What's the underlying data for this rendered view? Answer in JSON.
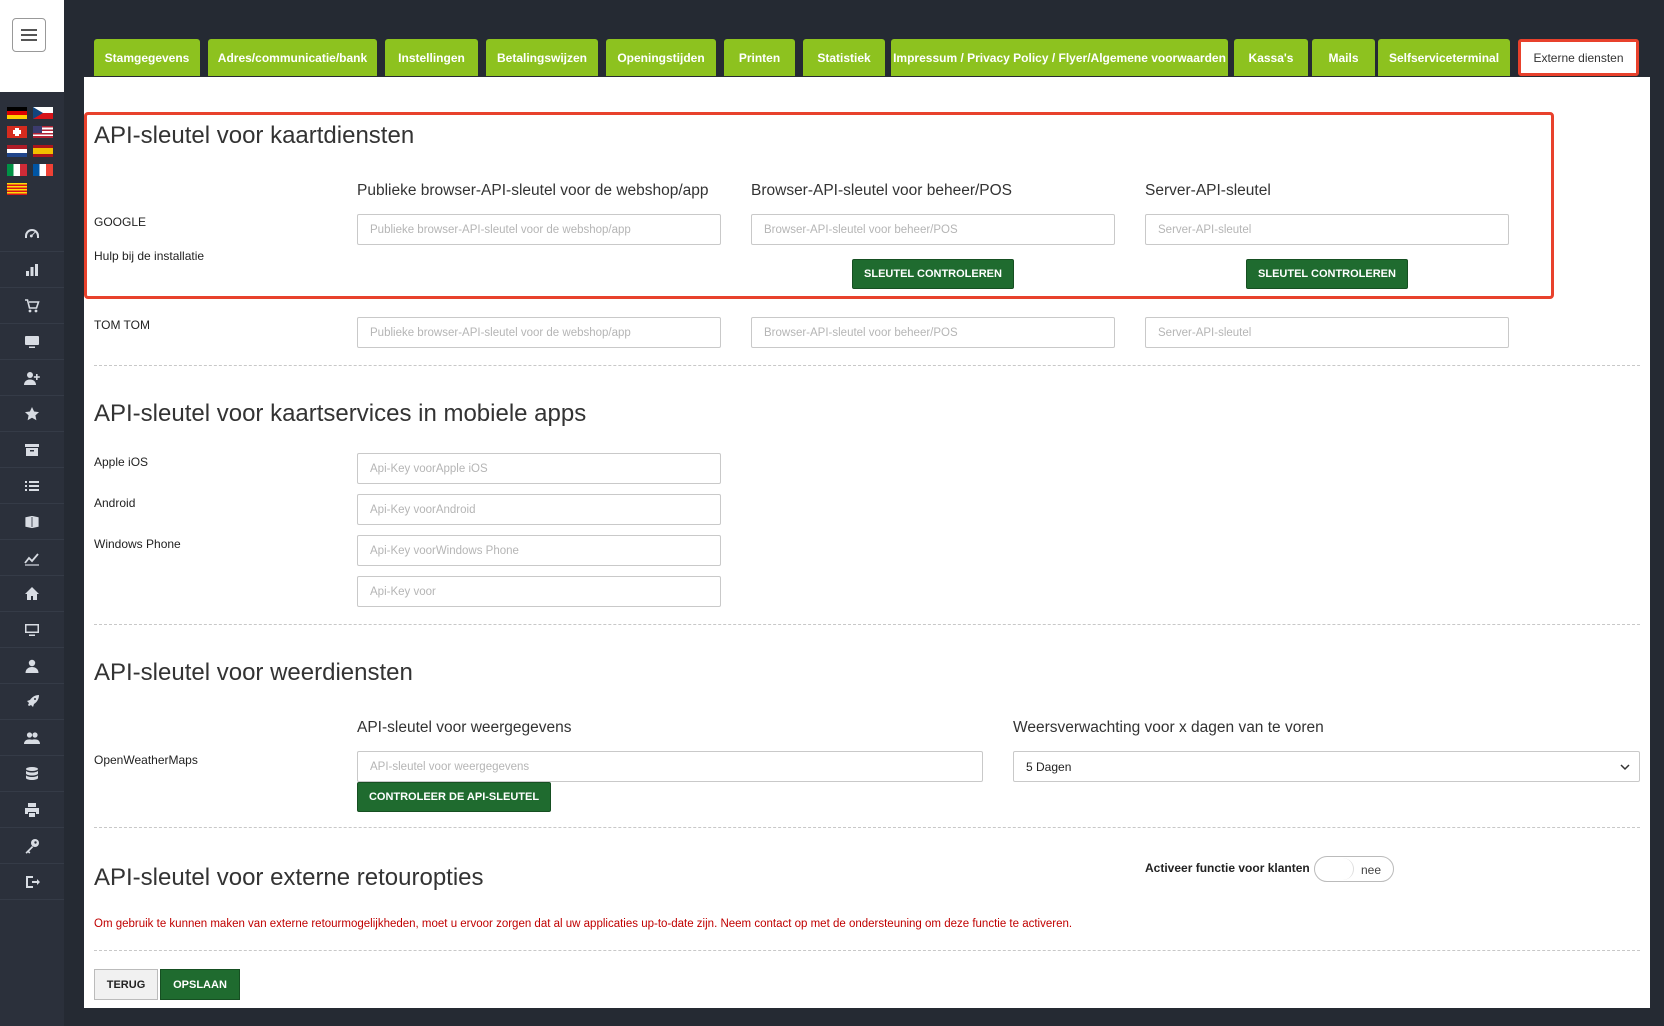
{
  "sidebar": {
    "flags": [
      {
        "icon": "flag-de-icon"
      },
      {
        "icon": "flag-cz-icon"
      },
      {
        "icon": "flag-ch-icon"
      },
      {
        "icon": "flag-us-icon"
      },
      {
        "icon": "flag-nl-icon"
      },
      {
        "icon": "flag-es-icon"
      },
      {
        "icon": "flag-it-icon"
      },
      {
        "icon": "flag-fr-icon"
      },
      {
        "icon": "flag-ca-icon"
      }
    ],
    "nav_icons": [
      "dashboard-icon",
      "bar-chart-icon",
      "cart-icon",
      "monitor-icon",
      "user-plus-icon",
      "star-icon",
      "archive-icon",
      "list-icon",
      "book-icon",
      "line-chart-icon",
      "home-icon",
      "desktop-icon",
      "user-icon",
      "rocket-icon",
      "users-icon",
      "database-icon",
      "printer-icon",
      "key-icon",
      "logout-icon"
    ]
  },
  "tabs": [
    {
      "label": "Stamgegevens"
    },
    {
      "label": "Adres/communicatie/bank"
    },
    {
      "label": "Instellingen"
    },
    {
      "label": "Betalingswijzen"
    },
    {
      "label": "Openingstijden"
    },
    {
      "label": "Printen"
    },
    {
      "label": "Statistiek"
    },
    {
      "label": "Impressum / Privacy Policy / Flyer/Algemene voorwaarden"
    },
    {
      "label": "Kassa's"
    },
    {
      "label": "Mails"
    },
    {
      "label": "Selfserviceterminal"
    },
    {
      "label": "Externe diensten"
    }
  ],
  "maps": {
    "title": "API-sleutel voor kaartdiensten",
    "col1": "Publieke browser-API-sleutel voor de webshop/app",
    "col2": "Browser-API-sleutel voor beheer/POS",
    "col3": "Server-API-sleutel",
    "google_label": "GOOGLE",
    "help_label": "Hulp bij de installatie",
    "tomtom_label": "TOM TOM",
    "ph_public": "Publieke browser-API-sleutel voor de webshop/app",
    "ph_browser": "Browser-API-sleutel voor beheer/POS",
    "ph_server": "Server-API-sleutel",
    "check_button": "SLEUTEL CONTROLEREN"
  },
  "mobile": {
    "title": "API-sleutel voor kaartservices in mobiele apps",
    "ios_label": "Apple iOS",
    "android_label": "Android",
    "windows_label": "Windows Phone",
    "ph_ios": "Api-Key voorApple iOS",
    "ph_android": "Api-Key voorAndroid",
    "ph_windows": "Api-Key voorWindows Phone",
    "ph_other": "Api-Key voor"
  },
  "weather": {
    "title": "API-sleutel voor weerdiensten",
    "col1": "API-sleutel voor weergegevens",
    "col2": "Weersverwachting voor x dagen van te voren",
    "provider_label": "OpenWeatherMaps",
    "ph_key": "API-sleutel voor weergegevens",
    "days_selected": "5 Dagen",
    "check_button": "CONTROLEER DE API-SLEUTEL"
  },
  "returns": {
    "title": "API-sleutel voor externe retouropties",
    "toggle_label": "Activeer functie voor klanten",
    "toggle_value": "nee",
    "warning": "Om gebruik te kunnen maken van externe retourmogelijkheden, moet u ervoor zorgen dat al uw applicaties up-to-date zijn. Neem contact op met de ondersteuning om deze functie te activeren."
  },
  "footer": {
    "back_button": "TERUG",
    "save_button": "OPSLAAN"
  },
  "colors": {
    "tab_green": "#8dc21f",
    "button_green": "#1f6b2f",
    "highlight_red": "#e8412c",
    "warning_red": "#c00000",
    "sidebar_bg": "#2b303b"
  }
}
